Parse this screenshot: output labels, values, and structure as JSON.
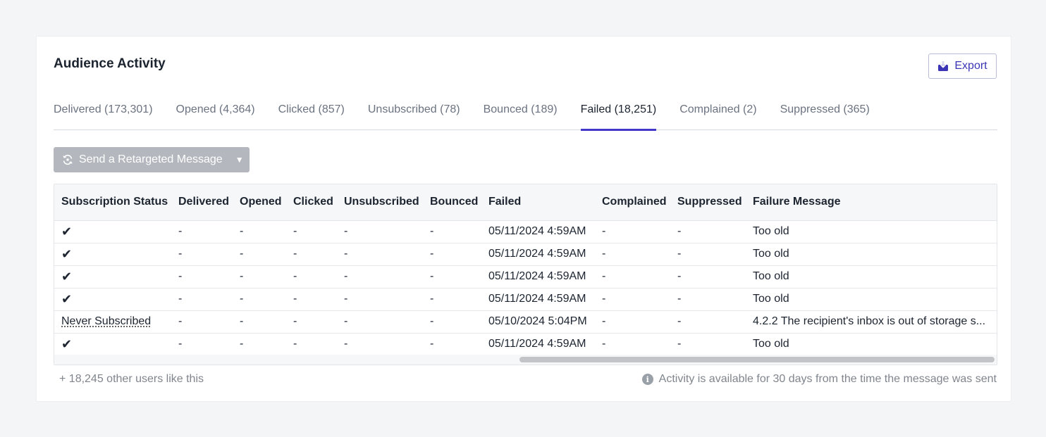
{
  "panel": {
    "title": "Audience Activity",
    "export_label": "Export",
    "accent_color": "#4338ca"
  },
  "tabs": [
    {
      "label": "Delivered (173,301)",
      "active": false
    },
    {
      "label": "Opened (4,364)",
      "active": false
    },
    {
      "label": "Clicked (857)",
      "active": false
    },
    {
      "label": "Unsubscribed (78)",
      "active": false
    },
    {
      "label": "Bounced (189)",
      "active": false
    },
    {
      "label": "Failed (18,251)",
      "active": true
    },
    {
      "label": "Complained (2)",
      "active": false
    },
    {
      "label": "Suppressed (365)",
      "active": false
    }
  ],
  "retarget": {
    "label": "Send a Retargeted Message",
    "icon": "retarget-icon",
    "disabled": true
  },
  "table": {
    "columns": [
      "Subscription Status",
      "Delivered",
      "Opened",
      "Clicked",
      "Unsubscribed",
      "Bounced",
      "Failed",
      "Complained",
      "Suppressed",
      "Failure Message"
    ],
    "rows": [
      {
        "status": "✔",
        "delivered": "-",
        "opened": "-",
        "clicked": "-",
        "unsubscribed": "-",
        "bounced": "-",
        "failed": "05/11/2024 4:59AM",
        "complained": "-",
        "suppressed": "-",
        "message": "Too old"
      },
      {
        "status": "✔",
        "delivered": "-",
        "opened": "-",
        "clicked": "-",
        "unsubscribed": "-",
        "bounced": "-",
        "failed": "05/11/2024 4:59AM",
        "complained": "-",
        "suppressed": "-",
        "message": "Too old"
      },
      {
        "status": "✔",
        "delivered": "-",
        "opened": "-",
        "clicked": "-",
        "unsubscribed": "-",
        "bounced": "-",
        "failed": "05/11/2024 4:59AM",
        "complained": "-",
        "suppressed": "-",
        "message": "Too old"
      },
      {
        "status": "✔",
        "delivered": "-",
        "opened": "-",
        "clicked": "-",
        "unsubscribed": "-",
        "bounced": "-",
        "failed": "05/11/2024 4:59AM",
        "complained": "-",
        "suppressed": "-",
        "message": "Too old"
      },
      {
        "status": "Never Subscribed",
        "delivered": "-",
        "opened": "-",
        "clicked": "-",
        "unsubscribed": "-",
        "bounced": "-",
        "failed": "05/10/2024 5:04PM",
        "complained": "-",
        "suppressed": "-",
        "message": "4.2.2 The recipient's inbox is out of storage s..."
      },
      {
        "status": "✔",
        "delivered": "-",
        "opened": "-",
        "clicked": "-",
        "unsubscribed": "-",
        "bounced": "-",
        "failed": "05/11/2024 4:59AM",
        "complained": "-",
        "suppressed": "-",
        "message": "Too old"
      }
    ]
  },
  "footer": {
    "others": "+ 18,245 other users like this",
    "notice": "Activity is available for 30 days from the time the message was sent",
    "notice_icon": "info-icon"
  }
}
